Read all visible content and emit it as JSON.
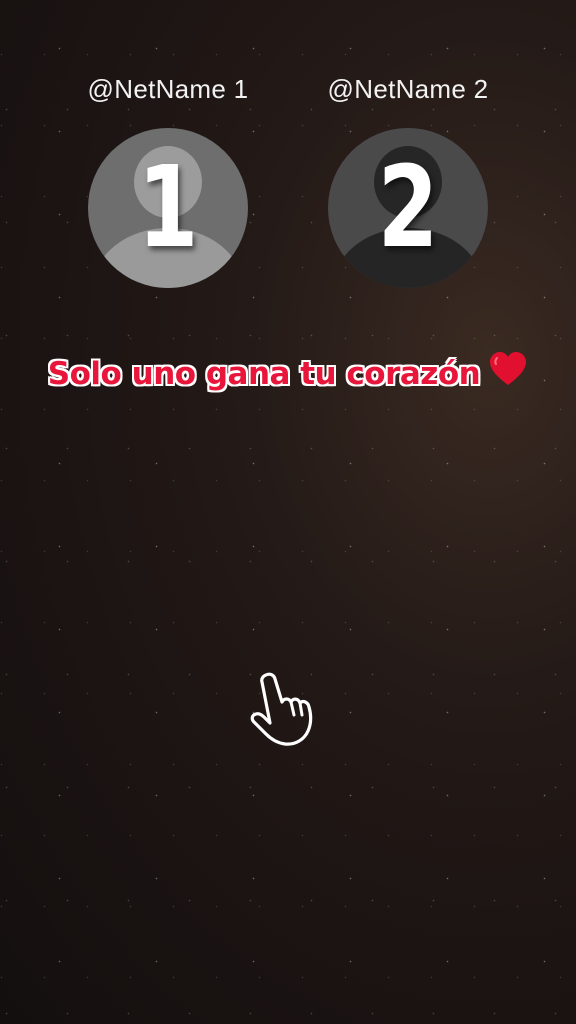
{
  "profiles": [
    {
      "username": "@NetName 1",
      "number": "1",
      "avatar_icon": "user-avatar-icon"
    },
    {
      "username": "@NetName 2",
      "number": "2",
      "avatar_icon": "user-avatar-icon"
    }
  ],
  "headline": {
    "text": "Solo uno gana tu corazón",
    "emoji_icon": "red-heart-icon"
  },
  "pointer": {
    "icon": "tap-hand-icon"
  },
  "colors": {
    "background": "#1a1312",
    "headline_fill": "#e8163b",
    "headline_outline": "#ffffff",
    "heart": "#e0102e"
  }
}
